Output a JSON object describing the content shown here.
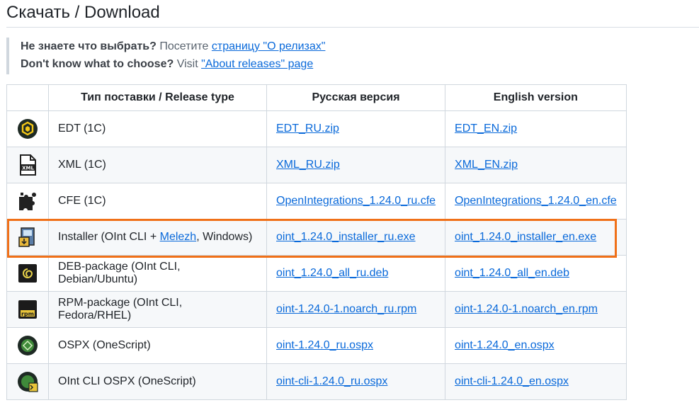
{
  "heading": "Скачать / Download",
  "note": {
    "ru_bold": "Не знаете что выбрать?",
    "ru_text": " Посетите ",
    "ru_link": "страницу \"О релизах\"",
    "en_bold": "Don't know what to choose?",
    "en_text": " Visit ",
    "en_link": "\"About releases\" page"
  },
  "table": {
    "headers": [
      "Тип поставки / Release type",
      "Русская версия",
      "English version"
    ],
    "rows": [
      {
        "icon": "edt-icon",
        "type": "EDT (1C)",
        "ru": "EDT_RU.zip",
        "en": "EDT_EN.zip"
      },
      {
        "icon": "xml-file-icon",
        "type": "XML (1C)",
        "ru": "XML_RU.zip",
        "en": "XML_EN.zip"
      },
      {
        "icon": "puzzle-icon",
        "type": "CFE (1C)",
        "ru": "OpenIntegrations_1.24.0_ru.cfe",
        "en": "OpenIntegrations_1.24.0_en.cfe"
      },
      {
        "icon": "installer-icon",
        "type_pre": "Installer (OInt CLI + ",
        "type_link": "Melezh",
        "type_post": ", Windows)",
        "ru": "oint_1.24.0_installer_ru.exe",
        "en": "oint_1.24.0_installer_en.exe"
      },
      {
        "icon": "deb-package-icon",
        "type": "DEB-package (OInt CLI, Debian/Ubuntu)",
        "ru": "oint_1.24.0_all_ru.deb",
        "en": "oint_1.24.0_all_en.deb"
      },
      {
        "icon": "rpm-package-icon",
        "type": "RPM-package (OInt CLI, Fedora/RHEL)",
        "ru": "oint-1.24.0-1.noarch_ru.rpm",
        "en": "oint-1.24.0-1.noarch_en.rpm"
      },
      {
        "icon": "onescript-icon",
        "type": "OSPX (OneScript)",
        "ru": "oint-1.24.0_ru.ospx",
        "en": "oint-1.24.0_en.ospx"
      },
      {
        "icon": "onescript-cli-icon",
        "type": "OInt CLI OSPX (OneScript)",
        "ru": "oint-cli-1.24.0_ru.ospx",
        "en": "oint-cli-1.24.0_en.ospx"
      }
    ]
  },
  "colors": {
    "link": "#0969da",
    "highlight": "#f07018"
  }
}
